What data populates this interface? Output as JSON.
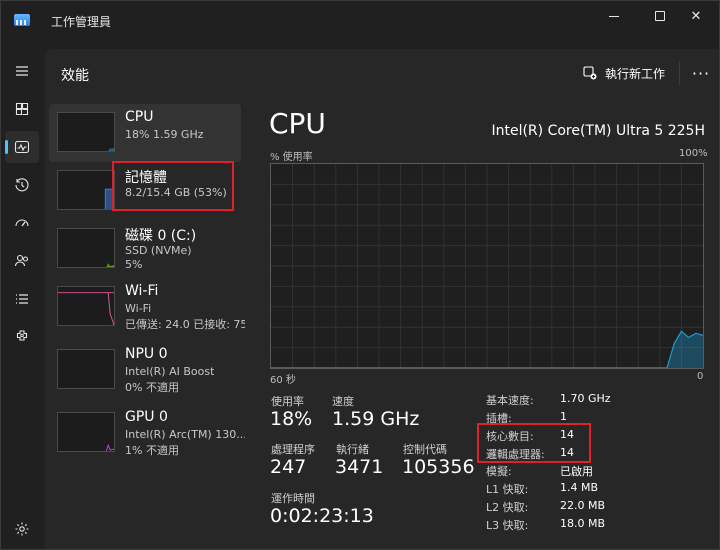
{
  "window": {
    "title": "工作管理員",
    "accent": "#4cc2ff"
  },
  "header": {
    "title": "效能",
    "run_task_label": "執行新工作",
    "more_label": "···"
  },
  "nav": [
    "menu-icon",
    "processes-icon",
    "performance-icon",
    "app-history-icon",
    "startup-icon",
    "users-icon",
    "details-icon",
    "services-icon",
    "settings-icon"
  ],
  "devices": [
    {
      "name": "CPU",
      "line1": "18%  1.59 GHz",
      "line2": ""
    },
    {
      "name": "記憶體",
      "line1": "8.2/15.4 GB (53%)",
      "line2": ""
    },
    {
      "name": "磁碟 0 (C:)",
      "line1": "SSD (NVMe)",
      "line2": "5%"
    },
    {
      "name": "Wi-Fi",
      "line1": "Wi-Fi",
      "line2": "已傳送: 24.0  已接收: 75"
    },
    {
      "name": "NPU 0",
      "line1": "Intel(R) AI Boost",
      "line2": "0%  不適用"
    },
    {
      "name": "GPU 0",
      "line1": "Intel(R) Arc(TM) 130...",
      "line2": "1%  不適用"
    }
  ],
  "detail": {
    "title": "CPU",
    "model": "Intel(R) Core(TM) Ultra 5 225H",
    "y_label": "% 使用率",
    "y_max": "100%",
    "x_left": "60 秒",
    "x_right": "0",
    "usage_label": "使用率",
    "usage_value": "18%",
    "speed_label": "速度",
    "speed_value": "1.59 GHz",
    "processes_label": "處理程序",
    "processes_value": "247",
    "threads_label": "執行緒",
    "threads_value": "3471",
    "handles_label": "控制代碼",
    "handles_value": "105356",
    "uptime_label": "運作時間",
    "uptime_value": "0:02:23:13",
    "specs": [
      {
        "key": "基本速度:",
        "value": "1.70 GHz"
      },
      {
        "key": "插槽:",
        "value": "1"
      },
      {
        "key": "核心數目:",
        "value": "14"
      },
      {
        "key": "邏輯處理器:",
        "value": "14"
      },
      {
        "key": "模擬:",
        "value": "已啟用"
      },
      {
        "key": "L1 快取:",
        "value": "1.4 MB"
      },
      {
        "key": "L2 快取:",
        "value": "22.0 MB"
      },
      {
        "key": "L3 快取:",
        "value": "18.0 MB"
      }
    ]
  },
  "chart_data": {
    "type": "area",
    "x": [
      60,
      5,
      4,
      3,
      2,
      1,
      0
    ],
    "values": [
      0,
      0,
      12,
      18,
      15,
      17,
      16
    ],
    "ylim": [
      0,
      100
    ]
  },
  "colors": {
    "cpu_line": "#1e9ad6",
    "memory_line": "#3b7be0",
    "disk_line": "#7bbf2a",
    "wifi_line": "#e0599a",
    "gpu_line": "#b04fd6",
    "highlight": "#e0202a"
  }
}
